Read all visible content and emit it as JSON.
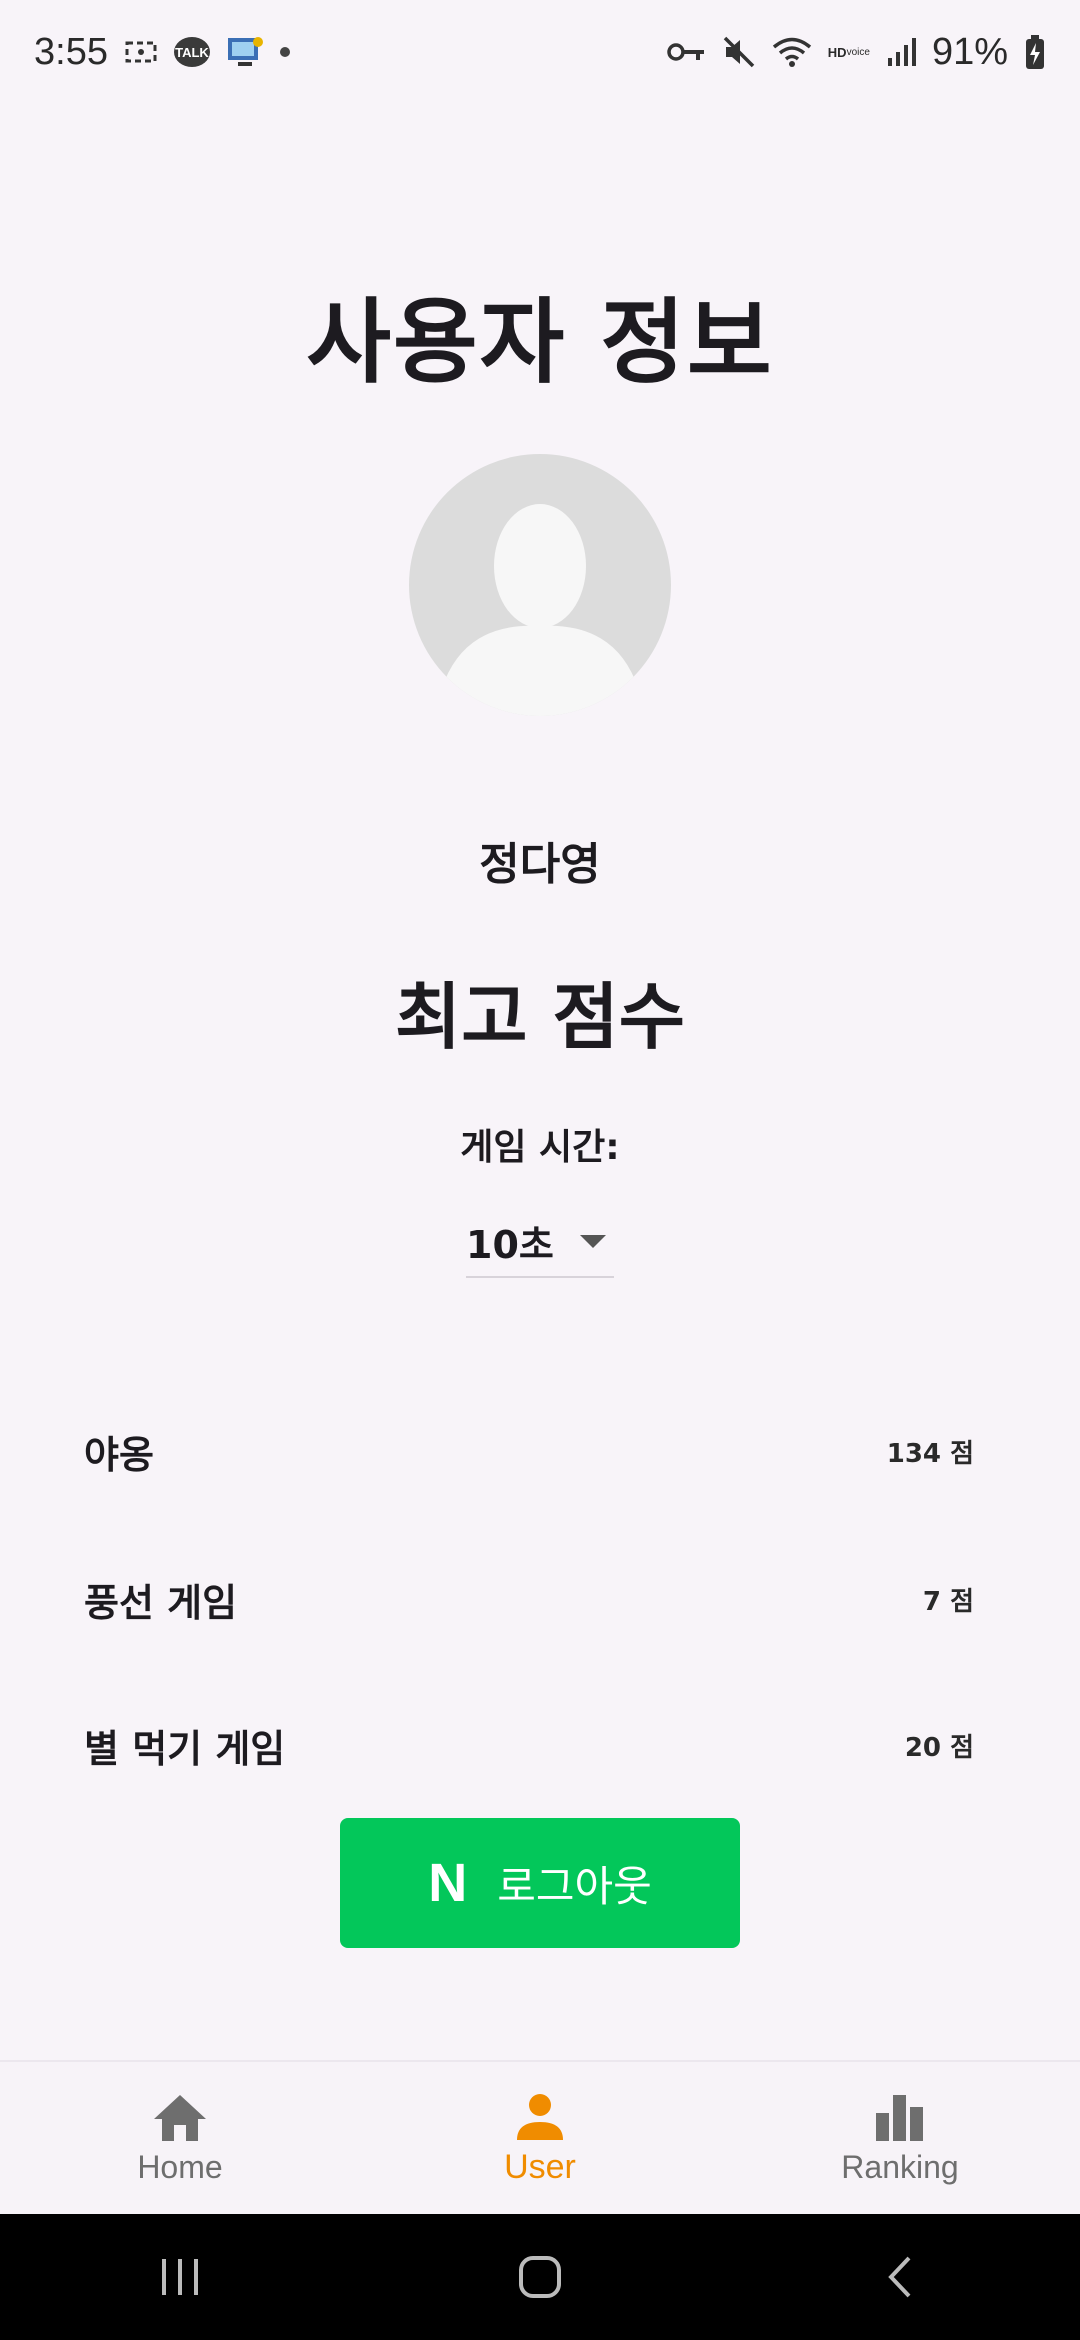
{
  "status_bar": {
    "time": "3:55",
    "talk_label": "TALK",
    "hd_label": "HD",
    "voice_label": "voice",
    "battery": "91%"
  },
  "page": {
    "title": "사용자 정보",
    "username": "정다영",
    "section_title": "최고 점수",
    "time_label": "게임 시간:"
  },
  "dropdown": {
    "selected": "10초"
  },
  "scores": [
    {
      "game": "야옹",
      "score": "134 점"
    },
    {
      "game": "풍선 게임",
      "score": "7 점"
    },
    {
      "game": "별 먹기 게임",
      "score": "20 점"
    }
  ],
  "logout": {
    "logo": "N",
    "label": "로그아웃",
    "color": "#03c75a"
  },
  "bottom_nav": {
    "items": [
      {
        "label": "Home",
        "icon": "home-icon",
        "active": false
      },
      {
        "label": "User",
        "icon": "person-icon",
        "active": true
      },
      {
        "label": "Ranking",
        "icon": "bar-chart-icon",
        "active": false
      }
    ],
    "active_color": "#f08c00",
    "inactive_color": "#6e6e6e"
  }
}
